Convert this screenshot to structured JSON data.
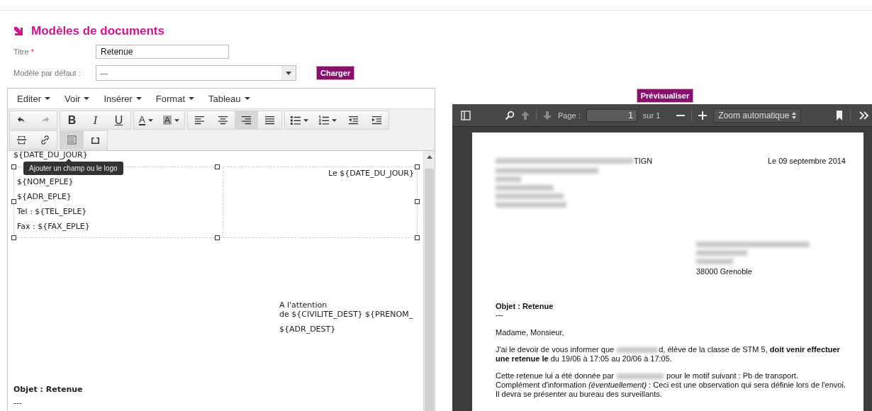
{
  "header": {
    "title": "Modèles de documents"
  },
  "form": {
    "title_label": "Titre",
    "required_mark": "*",
    "title_value": "Retenue",
    "model_label": "Modèle par défaut :",
    "model_value": "---",
    "load_button": "Charger"
  },
  "editor": {
    "menus": [
      "Editer",
      "Voir",
      "Insérer",
      "Format",
      "Tableau"
    ],
    "toolbar_rows": [
      [
        [
          {
            "kind": "undo",
            "disabled": false,
            "selected": false
          },
          {
            "kind": "redo",
            "disabled": true,
            "selected": false
          }
        ],
        [
          {
            "kind": "bold",
            "glyph": "B",
            "disabled": false,
            "selected": false
          },
          {
            "kind": "italic",
            "glyph": "I",
            "disabled": false,
            "selected": false
          },
          {
            "kind": "underline",
            "glyph": "U",
            "disabled": false,
            "selected": false
          }
        ],
        [
          {
            "kind": "forecolor",
            "glyph": "A",
            "disabled": false,
            "selected": false
          },
          {
            "kind": "backcolor",
            "glyph": "A",
            "disabled": false,
            "selected": false
          }
        ],
        [
          {
            "kind": "alignleft",
            "disabled": false,
            "selected": false
          },
          {
            "kind": "aligncenter",
            "disabled": false,
            "selected": false
          },
          {
            "kind": "alignright",
            "disabled": false,
            "selected": true
          },
          {
            "kind": "justify",
            "disabled": false,
            "selected": false
          }
        ],
        [
          {
            "kind": "bullist",
            "disabled": false,
            "selected": false
          },
          {
            "kind": "numlist",
            "disabled": false,
            "selected": false
          },
          {
            "kind": "outdent",
            "disabled": false,
            "selected": false
          },
          {
            "kind": "indent",
            "disabled": false,
            "selected": false
          }
        ]
      ],
      [
        [
          {
            "kind": "hr",
            "disabled": false,
            "selected": false
          },
          {
            "kind": "link",
            "disabled": false,
            "selected": false
          }
        ],
        [
          {
            "kind": "field",
            "disabled": false,
            "selected": true
          },
          {
            "kind": "frame",
            "disabled": false,
            "selected": false
          }
        ]
      ]
    ],
    "tooltip": "Ajouter un champ ou le logo",
    "content": {
      "top_field": "${DATE_DU_JOUR}",
      "sender_lines": [
        "${NOM_EPLE}",
        "${ADR_EPLE}",
        "Tel : ${TEL_EPLE}",
        "Fax : ${FAX_EPLE}"
      ],
      "date_line": "Le ${DATE_DU_JOUR}",
      "recipient_lines": [
        "A l'attention",
        "de ${CIVILITE_DEST} ${PRENOM_"
      ],
      "recipient_address": "${ADR_DEST}",
      "subject": "Objet : Retenue",
      "separator": "---"
    }
  },
  "preview_button": "Prévisualiser",
  "viewer": {
    "page_label": "Page :",
    "page_value": "1",
    "page_total": "sur 1",
    "zoom_value": "Zoom automatique",
    "letter": {
      "sender_tail": "TIGN",
      "date": "Le 09 septembre 2014",
      "recipient_city": "38000 Grenoble",
      "subject": "Objet : Retenue",
      "separator": "---",
      "greeting": "Madame, Monsieur,",
      "paragraph_1": {
        "before": "J'ai le devoir de vous informer que ",
        "after": "d, élève de la classe de STM 5, **doit venir effectuer une retenue le** du 19/06 à 17:05 au 20/06 à 17:05."
      },
      "paragraph_2": {
        "before": "Cette retenue lui a été donnée par ",
        "after": " pour le motif suivant : Pb de transport."
      },
      "lines": [
        "Complément d'information *(éventuellement)* : Ceci est une observation qui sera définie lors de l'envoi.",
        "Il devra se présenter au bureau des surveillants."
      ]
    }
  }
}
